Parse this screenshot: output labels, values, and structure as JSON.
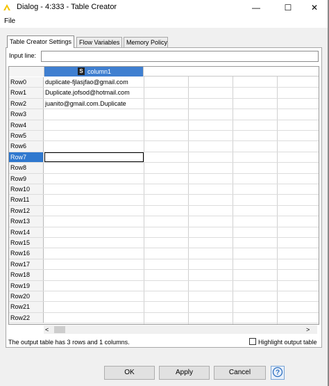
{
  "window": {
    "title": "Dialog - 4:333 - Table Creator",
    "minimize": "—",
    "maximize": "☐",
    "close": "✕"
  },
  "menu": {
    "file": "File"
  },
  "tabs": [
    {
      "label": "Table Creator Settings",
      "active": true
    },
    {
      "label": "Flow Variables",
      "active": false
    },
    {
      "label": "Memory Policy",
      "active": false
    }
  ],
  "input_line": {
    "label": "Input line:",
    "value": ""
  },
  "table": {
    "column": {
      "type_badge": "S",
      "name": "column1"
    },
    "rows": [
      {
        "label": "Row0",
        "value": "duplicate-fjlasjfao@gmail.com"
      },
      {
        "label": "Row1",
        "value": "Duplicate.jofsod@hotmail.com"
      },
      {
        "label": "Row2",
        "value": "juanito@gmail.com.Duplicate"
      },
      {
        "label": "Row3",
        "value": ""
      },
      {
        "label": "Row4",
        "value": ""
      },
      {
        "label": "Row5",
        "value": ""
      },
      {
        "label": "Row6",
        "value": ""
      },
      {
        "label": "Row7",
        "value": ""
      },
      {
        "label": "Row8",
        "value": ""
      },
      {
        "label": "Row9",
        "value": ""
      },
      {
        "label": "Row10",
        "value": ""
      },
      {
        "label": "Row11",
        "value": ""
      },
      {
        "label": "Row12",
        "value": ""
      },
      {
        "label": "Row13",
        "value": ""
      },
      {
        "label": "Row14",
        "value": ""
      },
      {
        "label": "Row15",
        "value": ""
      },
      {
        "label": "Row16",
        "value": ""
      },
      {
        "label": "Row17",
        "value": ""
      },
      {
        "label": "Row18",
        "value": ""
      },
      {
        "label": "Row19",
        "value": ""
      },
      {
        "label": "Row20",
        "value": ""
      },
      {
        "label": "Row21",
        "value": ""
      },
      {
        "label": "Row22",
        "value": ""
      }
    ],
    "selected_row": "Row7"
  },
  "scroll": {
    "left": "<",
    "right": ">"
  },
  "status": {
    "text": "The output table has 3 rows and 1 columns.",
    "highlight_label": "Highlight output table",
    "highlight_checked": false
  },
  "buttons": {
    "ok": "OK",
    "apply": "Apply",
    "cancel": "Cancel",
    "help": "?"
  },
  "colors": {
    "selection": "#3f7fd0",
    "knime_icon": "#f5c400"
  }
}
